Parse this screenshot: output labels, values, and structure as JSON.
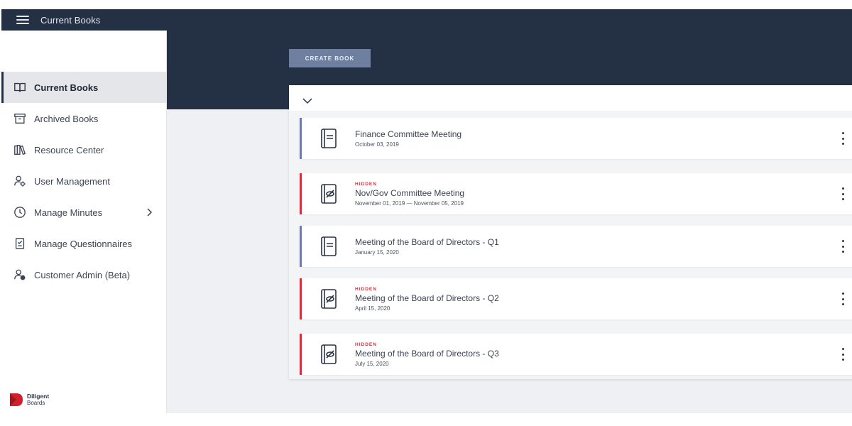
{
  "header": {
    "title": "Current Books",
    "menu_icon": "hamburger-icon"
  },
  "sidebar": {
    "items": [
      {
        "label": "Current Books",
        "icon": "book-open-icon",
        "active": true
      },
      {
        "label": "Archived Books",
        "icon": "archive-box-icon"
      },
      {
        "label": "Resource Center",
        "icon": "books-shelf-icon"
      },
      {
        "label": "User Management",
        "icon": "user-gear-icon"
      },
      {
        "label": "Manage Minutes",
        "icon": "clock-icon",
        "has_submenu": true
      },
      {
        "label": "Manage Questionnaires",
        "icon": "clipboard-check-icon"
      },
      {
        "label": "Customer Admin (Beta)",
        "icon": "user-admin-icon"
      }
    ],
    "brand": {
      "line1": "Diligent",
      "line2": "Boards"
    }
  },
  "main": {
    "create_label": "CREATE BOOK",
    "books": [
      {
        "hidden": false,
        "tag": "",
        "title": "Finance Committee Meeting",
        "date": "October 03, 2019",
        "stripe": "#6f7aa6"
      },
      {
        "hidden": true,
        "tag": "HIDDEN",
        "title": "Nov/Gov Committee Meeting",
        "date": "November 01, 2019 — November 05, 2019",
        "stripe": "#d0323f"
      },
      {
        "hidden": false,
        "tag": "",
        "title": "Meeting of the Board of Directors - Q1",
        "date": "January 15, 2020",
        "stripe": "#6f7aa6"
      },
      {
        "hidden": true,
        "tag": "HIDDEN",
        "title": "Meeting of the Board of Directors - Q2",
        "date": "April 15, 2020",
        "stripe": "#d0323f"
      },
      {
        "hidden": true,
        "tag": "HIDDEN",
        "title": "Meeting of the Board of Directors - Q3",
        "date": "July 15, 2020",
        "stripe": "#d0323f"
      }
    ]
  },
  "colors": {
    "navy": "#243044",
    "hidden_red": "#c8323f",
    "create_button": "#6e7f9f",
    "brand_red": "#d0202e"
  }
}
